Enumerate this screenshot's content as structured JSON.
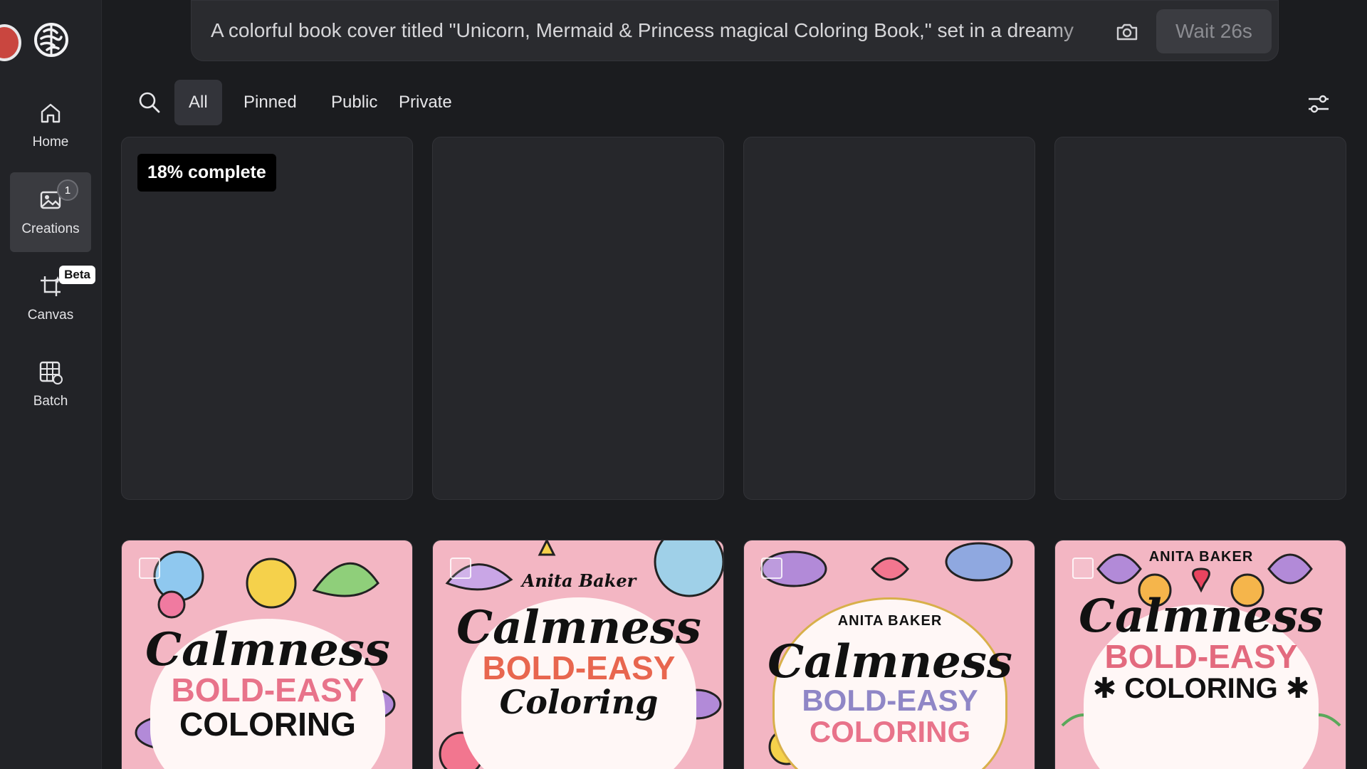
{
  "sidebar": {
    "items": [
      {
        "label": "Home",
        "icon": "home-icon"
      },
      {
        "label": "Creations",
        "icon": "image-icon",
        "badge": "1"
      },
      {
        "label": "Canvas",
        "icon": "crop-icon",
        "badge": "Beta"
      },
      {
        "label": "Batch",
        "icon": "grid-icon"
      }
    ]
  },
  "prompt": {
    "text": "A colorful book cover titled \"Unicorn, Mermaid & Princess magical Coloring Book,\" set in a dreamy",
    "wait_label": "Wait 26s"
  },
  "filters": {
    "tabs": [
      "All",
      "Pinned",
      "Public",
      "Private"
    ],
    "active": "All"
  },
  "pending": {
    "progress_label": "18% complete",
    "progress_percent": 18
  },
  "covers": [
    {
      "author": "",
      "title": "Calmness",
      "sub": "BOLD-EASY",
      "kind": "COLORING",
      "sub_color": "#e8738a"
    },
    {
      "author": "Anita Baker",
      "title": "Calmness",
      "sub": "BOLD-EASY",
      "kind": "Coloring",
      "sub_color": "#e8664f"
    },
    {
      "author": "ANITA BAKER",
      "title": "Calmness",
      "sub": "BOLD-EASY",
      "kind": "COLORING",
      "sub_color": "#8f86c6"
    },
    {
      "author": "ANITA BAKER",
      "title": "Calmness",
      "sub": "BOLD-EASY",
      "kind": "COLORING",
      "sub_color": "#e36a7e"
    }
  ],
  "colors": {
    "background": "#1b1c1f",
    "sidebar": "#222327",
    "card": "#26272b",
    "cover_pink": "#f3b6c3"
  }
}
